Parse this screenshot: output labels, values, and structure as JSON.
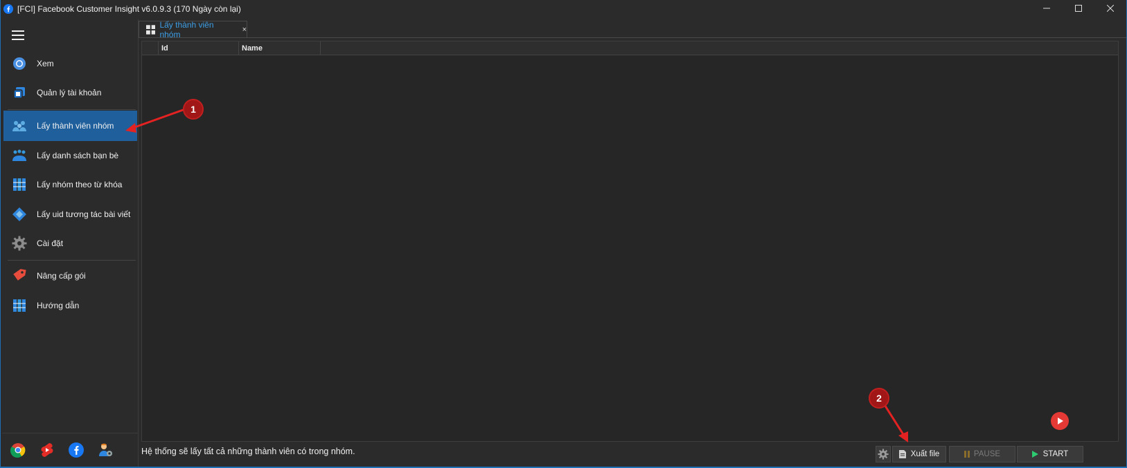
{
  "window": {
    "title": "[FCI] Facebook Customer Insight v6.0.9.3 (170 Ngày còn lại)"
  },
  "sidebar": {
    "items": [
      {
        "label": "Xem",
        "icon": "chrome-icon"
      },
      {
        "label": "Quản lý tài khoản",
        "icon": "account-manage-icon"
      },
      {
        "label": "Lấy thành viên nhóm",
        "icon": "group-members-icon",
        "active": true
      },
      {
        "label": "Lấy danh sách bạn bè",
        "icon": "friends-list-icon"
      },
      {
        "label": "Lấy nhóm theo từ khóa",
        "icon": "keyword-groups-icon"
      },
      {
        "label": "Lấy uid tương tác bài viết",
        "icon": "post-interaction-icon"
      },
      {
        "label": "Cài đặt",
        "icon": "gear-icon"
      },
      {
        "label": "Nâng cấp gói",
        "icon": "upgrade-tag-icon"
      },
      {
        "label": "Hướng dẫn",
        "icon": "guide-icon"
      }
    ],
    "bottom_icons": [
      "chrome-icon",
      "youtube-shorts-icon",
      "facebook-icon",
      "support-agent-icon"
    ]
  },
  "tabs": [
    {
      "label": "Lấy thành viên nhóm",
      "close": "×"
    }
  ],
  "grid": {
    "columns": [
      "Id",
      "Name"
    ],
    "rows": []
  },
  "status": {
    "text": "Hệ thống sẽ lấy tất cả những thành viên có trong nhóm."
  },
  "buttons": {
    "export": "Xuất file",
    "pause": "PAUSE",
    "start": "START"
  },
  "annotations": {
    "marker1": "1",
    "marker2": "2"
  },
  "colors": {
    "accent": "#1e5f9c",
    "tab_text": "#3c9ee5",
    "annotation": "#a11616",
    "arrow": "#e52222"
  }
}
